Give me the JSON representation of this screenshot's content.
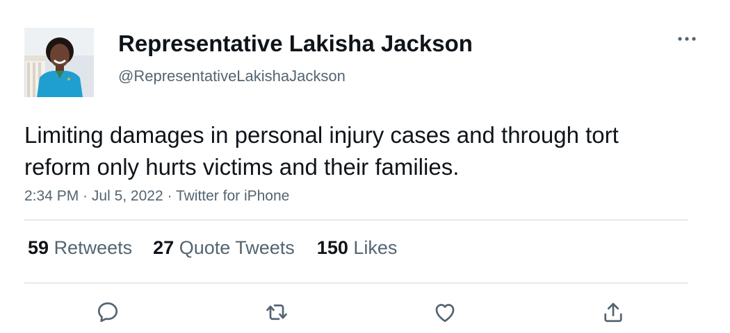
{
  "author": {
    "name": "Representative Lakisha Jackson",
    "handle": "@RepresentativeLakishaJackson"
  },
  "tweet": {
    "text": "Limiting damages in personal injury cases and through tort reform only hurts victims and their families.",
    "time": "2:34 PM",
    "separator": " · ",
    "date": "Jul 5, 2022",
    "source": "Twitter for iPhone"
  },
  "stats": {
    "retweets": {
      "count": "59",
      "label": "Retweets"
    },
    "quote_tweets": {
      "count": "27",
      "label": "Quote Tweets"
    },
    "likes": {
      "count": "150",
      "label": "Likes"
    }
  },
  "actions": [
    {
      "icon": "reply-icon"
    },
    {
      "icon": "retweet-icon"
    },
    {
      "icon": "like-icon"
    },
    {
      "icon": "share-icon"
    }
  ],
  "colors": {
    "text_primary": "#0f1419",
    "text_secondary": "#536471",
    "divider": "#e6e9ec",
    "icon": "#536471"
  }
}
